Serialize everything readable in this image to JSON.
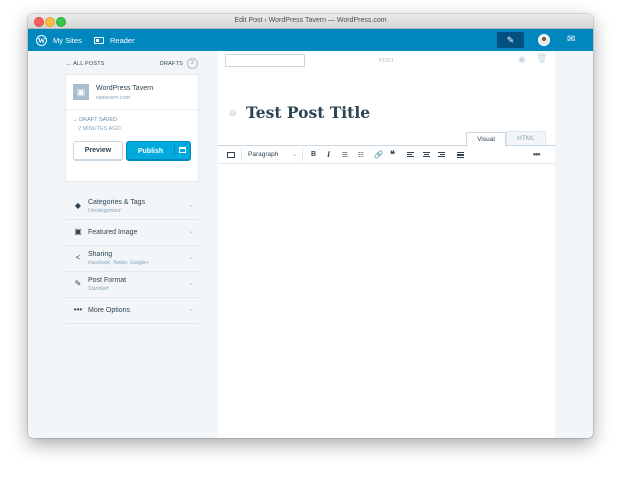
{
  "window": {
    "title": "Edit Post ‹ WordPress Tavern — WordPress.com"
  },
  "masterbar": {
    "my_sites": "My Sites",
    "reader": "Reader",
    "logo_glyph": "W",
    "write_glyph": "✎",
    "notif_glyph": "✉"
  },
  "sidebar": {
    "all_posts": "← ALL POSTS",
    "drafts_label": "DRAFTS",
    "drafts_count": "2",
    "site": {
      "name": "WordPress Tavern",
      "url": "wptavern.com",
      "blavatar_glyph": "▣"
    },
    "status": "DRAFT SAVED",
    "status_prefix": "⌄",
    "saved_time": "2 MINUTES AGO",
    "preview_label": "Preview",
    "publish_label": "Publish",
    "chevron": "⌄",
    "accordions": [
      {
        "icon": "◆",
        "title": "Categories & Tags",
        "subtitle": "Uncategorized"
      },
      {
        "icon": "▣",
        "title": "Featured Image",
        "subtitle": ""
      },
      {
        "icon": "<",
        "title": "Sharing",
        "subtitle": "Facebook, Twitter, Google+"
      },
      {
        "icon": "✎",
        "title": "Post Format",
        "subtitle": "Standard"
      },
      {
        "icon": "•••",
        "title": "More Options",
        "subtitle": ""
      }
    ]
  },
  "editor": {
    "slug_value": "",
    "post_type_label": "POST",
    "eye_glyph": "◉",
    "trash_glyph": "🗑",
    "link_glyph": "⊖",
    "post_title": "Test Post Title",
    "tabs": {
      "visual": "Visual",
      "html": "HTML"
    },
    "toolbar": {
      "format": "Paragraph",
      "format_chevron": "⌄",
      "bold": "B",
      "italic": "I",
      "ul": "☰",
      "ol": "☷",
      "link": "🔗",
      "quote": "❝",
      "more": "•••"
    }
  },
  "colors": {
    "masterbar": "#0087be",
    "publish": "#00aadc",
    "text": "#2e4453",
    "muted": "#87a6bc"
  }
}
